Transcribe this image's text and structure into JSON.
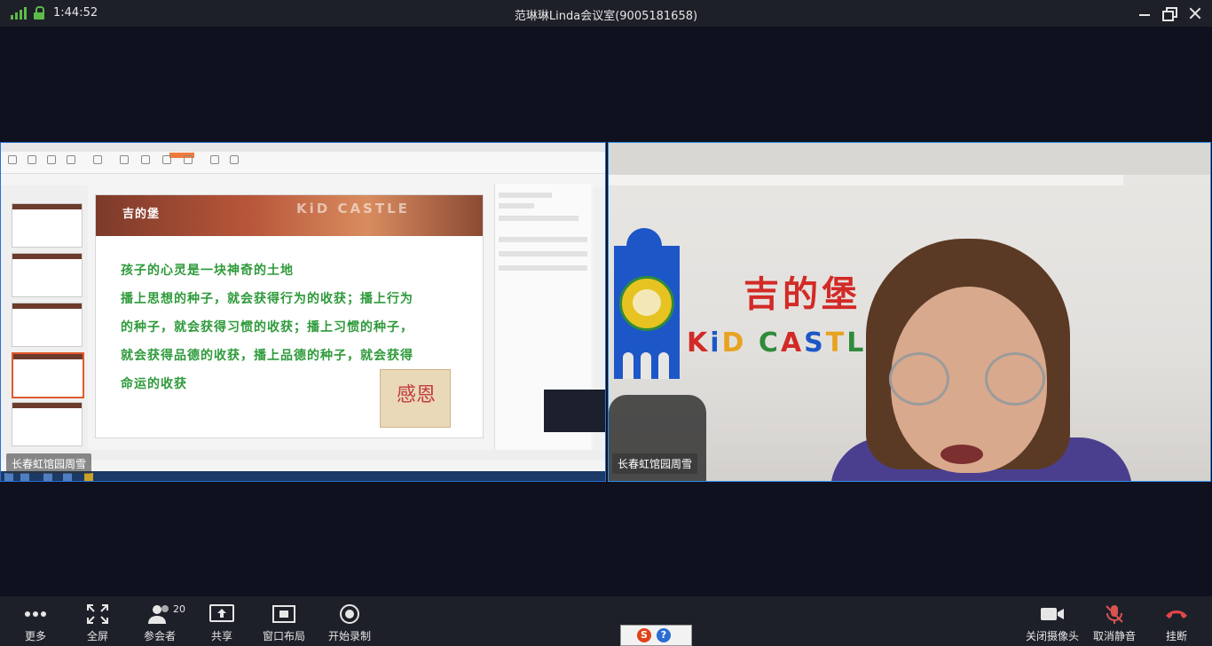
{
  "status": {
    "time": "1:44:52"
  },
  "window": {
    "title": "范琳琳Linda会议室(9005181658)"
  },
  "participants": [
    {
      "name": "长春虹馆园周雪"
    },
    {
      "name": "长春虹馆园周雪"
    }
  ],
  "slide": {
    "brand": "KiD CASTLE",
    "logo": "吉的堡",
    "lines": [
      "孩子的心灵是一块神奇的土地",
      "播上思想的种子，就会获得行为的收获；播上行为",
      "的种子，就会获得习惯的收获；播上习惯的种子，",
      "就会获得品德的收获，播上品德的种子，就会获得",
      "命运的收获"
    ],
    "stamp": "感恩"
  },
  "camera": {
    "sign_cn": "吉的堡",
    "sign_en_letters": [
      "K",
      "i",
      "D",
      " ",
      "C",
      "A",
      "S",
      "T",
      "L"
    ],
    "sign_en_colors": [
      "#d22a27",
      "#1d57c7",
      "#e7a321",
      "#fff",
      "#2f8b3b",
      "#d22a27",
      "#1d57c7",
      "#e7a321",
      "#2f8b3b"
    ]
  },
  "toolbar": {
    "more": "更多",
    "fullscreen": "全屏",
    "participants": "参会者",
    "participants_count": "20",
    "share": "共享",
    "layout": "窗口布局",
    "record": "开始录制",
    "camera_off": "关闭摄像头",
    "unmute": "取消静音",
    "hangup": "挂断"
  },
  "ime": {
    "s": "S",
    "help": "?"
  },
  "colors": {
    "signal": "#5dbb4a",
    "mute": "#d9534f",
    "hangup": "#e2474a"
  }
}
